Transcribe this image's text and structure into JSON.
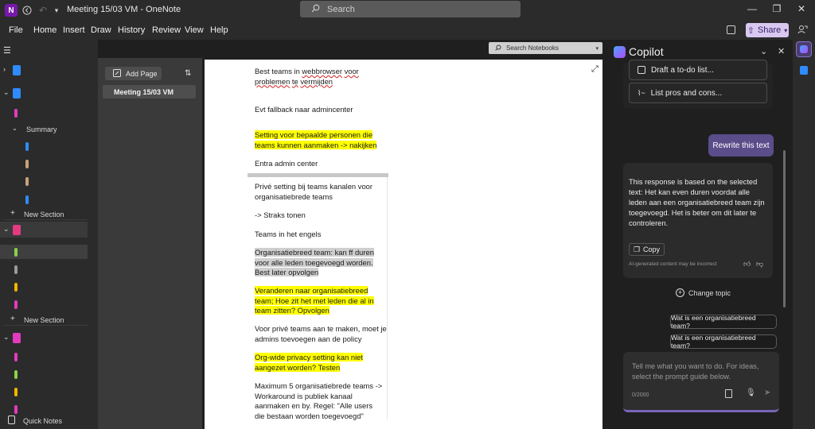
{
  "titlebar": {
    "app_icon_letter": "N",
    "title": "Meeting 15/03 VM  -  OneNote",
    "search_placeholder": "Search",
    "search_icon": "search-icon"
  },
  "menu": [
    "File",
    "Home",
    "Insert",
    "Draw",
    "History",
    "Review",
    "View",
    "Help"
  ],
  "share": {
    "label": "Share"
  },
  "nav": {
    "section_summary": "Summary",
    "new_section_1": "New Section",
    "new_section_2": "New Section",
    "quick_notes": "Quick Notes"
  },
  "pages": {
    "add_page": "Add Page",
    "items": [
      "Meeting 15/03 VM"
    ]
  },
  "search_notebooks": {
    "placeholder": "Search Notebooks"
  },
  "note": {
    "p1": [
      "Best teams in ",
      "webbrowser",
      " ",
      "voor",
      "",
      "problemen",
      " ",
      "te",
      " ",
      "vermijden",
      ""
    ],
    "p2": "Evt fallback naar admincenter",
    "p3": "Setting voor bepaalde personen die teams kunnen aanmaken -> nakijken",
    "p4": "Entra admin center",
    "p5": "Privé setting bij teams kanalen voor organisatiebrede teams",
    "p6": "-> Straks tonen",
    "p7": "Teams in het engels",
    "p8": "Organisatiebreed team: kan ff duren voor alle leden toegevoegd worden. Best later opvolgen",
    "p9": "Veranderen naar organisatiebreed team; Hoe zit het met leden die al in team zitten? Opvolgen",
    "p10": "Voor privé teams aan te maken, moet je admins toevoegen aan de policy",
    "p11": "Org-wide privacy setting kan niet aangezet worden? Testen",
    "p12": "Maximum 5 organisatiebrede teams -> Workaround is publiek kanaal aanmaken en by. Regel: \"Alle users die bestaan worden toegevoegd\""
  },
  "copilot": {
    "title": "Copilot",
    "prompt1": "Draft a to-do list...",
    "prompt2": "List pros and cons...",
    "user_msg": "Rewrite this text",
    "response": "This response is based on the selected text: Het kan even duren voordat alle leden aan een organisatiebreed team zijn toegevoegd. Het is beter om dit later te controleren.",
    "copy": "Copy",
    "ai_note": "AI-generated content may be incorrect",
    "change_topic": "Change topic",
    "suggestion1": "Wat is een organisatiebreed team?",
    "suggestion2": "Wat is een organisatiebreed team?",
    "input_placeholder": "Tell me what you want to do. For ideas, select the prompt guide below.",
    "char_count": "0/2000",
    "accent": "#7a64b8"
  }
}
